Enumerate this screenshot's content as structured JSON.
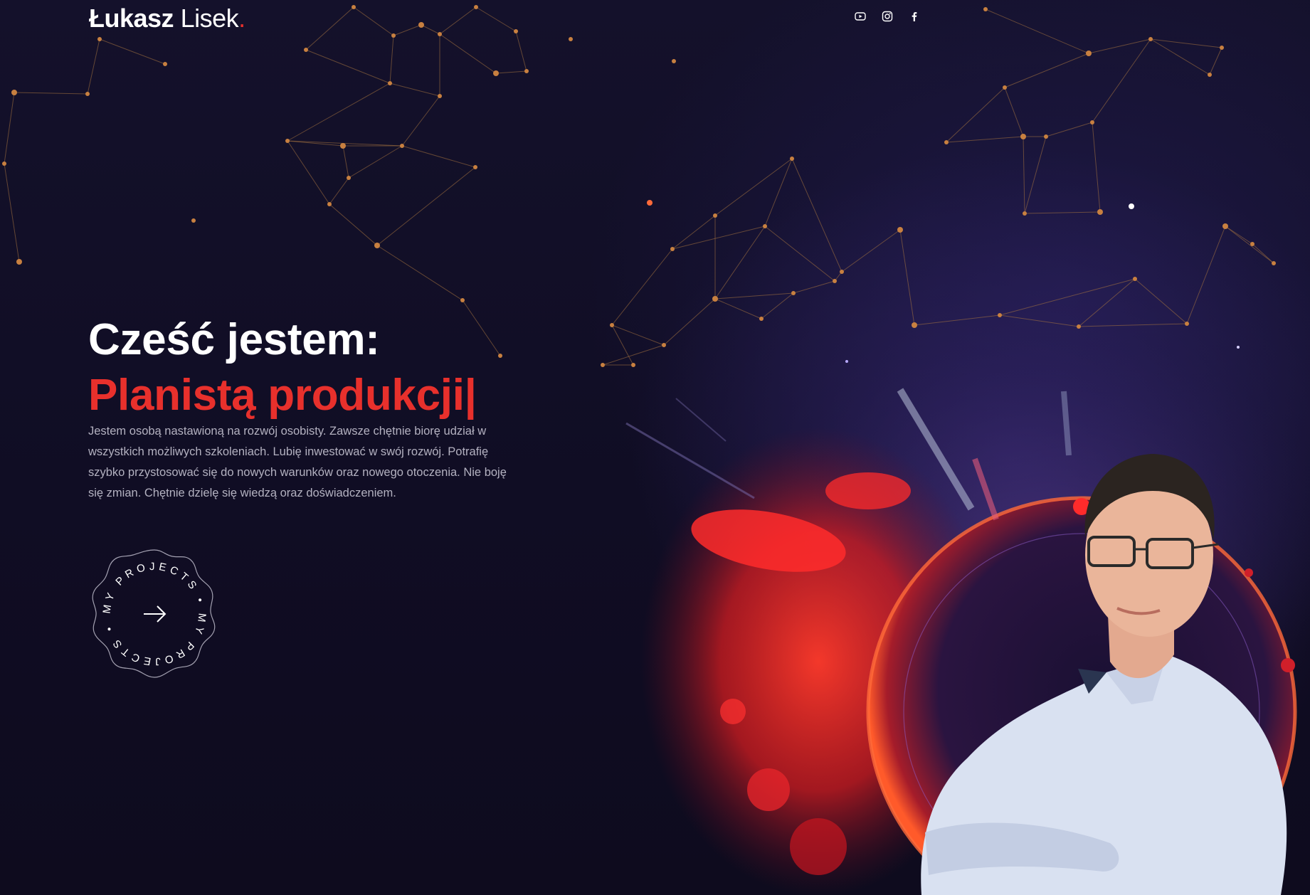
{
  "header": {
    "logo_first": "Łukasz",
    "logo_last": "Lisek",
    "logo_dot": ".",
    "social": [
      {
        "icon": "youtube-icon"
      },
      {
        "icon": "instagram-icon"
      },
      {
        "icon": "facebook-icon"
      }
    ]
  },
  "hero": {
    "greeting": "Cześć jestem:",
    "role": "Planistą produkcji|",
    "description": "Jestem osobą nastawioną na rozwój osobisty. Zawsze chętnie biorę udział w wszystkich możliwych szkoleniach. Lubię inwestować w swój rozwój. Potrafię szybko przystosować się do nowych warunków oraz nowego otoczenia. Nie boję się zmian. Chętnie dzielę się wiedzą oraz doświadczeniem.",
    "projects_badge_text": "MY PROJECTS • MY PROJECTS •"
  },
  "colors": {
    "accent": "#e8302c",
    "background": "#100d22",
    "network_node": "#d28a45"
  }
}
